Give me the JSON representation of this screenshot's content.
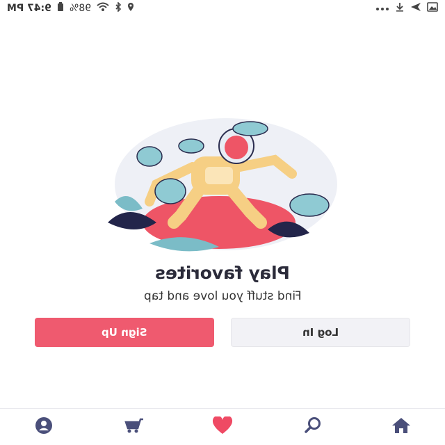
{
  "status_bar": {
    "time": "9:47 PM",
    "battery": "98%"
  },
  "main": {
    "title": "Play favorites",
    "subtitle": "Find stuff you love and tap"
  },
  "buttons": {
    "sign_up": "Sign Up",
    "log_in": "Log In"
  },
  "bottom_nav": {
    "items": [
      "profile-icon",
      "cart-icon",
      "heart-icon",
      "search-icon",
      "home-icon"
    ],
    "active": "heart-icon"
  },
  "colors": {
    "accent": "#ef5a6f",
    "nav_icon": "#4a4f7a",
    "secondary_button": "#f2f2f6"
  }
}
